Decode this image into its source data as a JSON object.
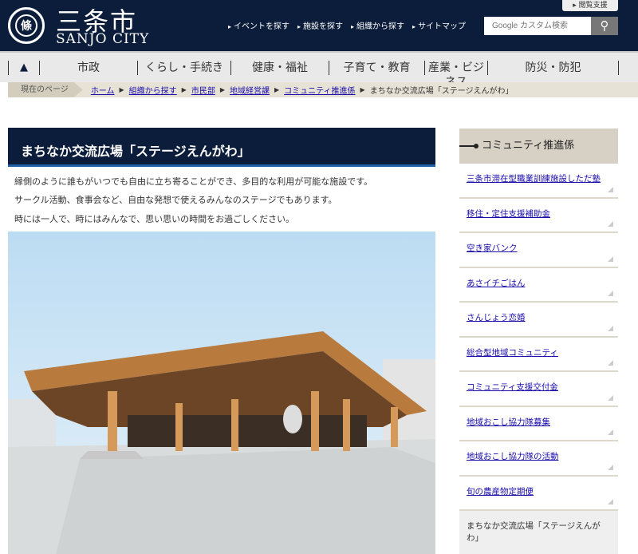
{
  "header": {
    "logo_mark": "條",
    "logo_jp": "三条市",
    "logo_en": "SANJO CITY",
    "assist": "▸ 閲覧支援",
    "links": [
      "イベントを探す",
      "施設を探す",
      "組織から探す",
      "サイトマップ"
    ],
    "search_placeholder": "Google カスタム検索",
    "search_icon": "search-icon"
  },
  "nav": {
    "home_icon": "home-icon",
    "items": [
      "市政",
      "くらし・手続き",
      "健康・福祉",
      "子育て・教育",
      "産業・ビジネス",
      "防災・防犯"
    ]
  },
  "breadcrumb": {
    "label": "現在のページ",
    "links": [
      "ホーム",
      "組織から探す",
      "市民部",
      "地域経営課",
      "コミュニティ推進係"
    ],
    "current": "まちなか交流広場「ステージえんがわ」"
  },
  "main": {
    "title": "まちなか交流広場「ステージえんがわ」",
    "paragraphs": [
      "縁側のように誰もがいつでも自由に立ち寄ることができ、多目的な利用が可能な施設です。",
      "サークル活動、食事会など、自由な発想で使えるみんなのステージでもあります。",
      "時には一人で、時にはみんなで、思い思いの時間をお過ごしください。"
    ]
  },
  "sidebar": {
    "title": "コミュニティ推進係",
    "items": [
      "三条市滞在型職業訓練施設しただ塾",
      "移住・定住支援補助金",
      "空き家バンク",
      "あさイチごはん",
      "さんじょう恋婚",
      "総合型地域コミュニティ",
      "コミュニティ支援交付金",
      "地域おこし協力隊募集",
      "地域おこし協力隊の活動",
      "旬の農産物定期便"
    ],
    "current": "まちなか交流広場「ステージえんがわ」"
  }
}
